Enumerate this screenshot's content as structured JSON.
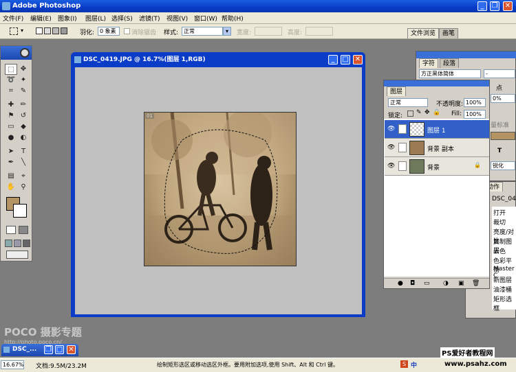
{
  "app": {
    "title": "Adobe Photoshop",
    "logo_icon": "photoshop-icon"
  },
  "menu": [
    "文件(F)",
    "编辑(E)",
    "图象(I)",
    "图层(L)",
    "选择(S)",
    "滤镜(T)",
    "视图(V)",
    "窗口(W)",
    "帮助(H)"
  ],
  "options": {
    "feather_label": "羽化:",
    "feather_value": "0 象素",
    "antialias_label": "消除锯齿",
    "style_label": "样式:",
    "style_value": "正常",
    "width_label": "宽度:",
    "height_label": "高度:",
    "tabs": [
      "文件浏览",
      "画笔"
    ]
  },
  "document": {
    "title": "DSC_0419.JPG @ 16.7%(图层 1,RGB)",
    "badge": "01"
  },
  "char_panel": {
    "tabs": [
      "字符",
      "段落"
    ],
    "font": "方正黑体简体",
    "dash": "-",
    "pt": "点",
    "percent": "0%",
    "scale": "量标准",
    "aa": "锐化"
  },
  "history_panel": {
    "tabs": [
      "记录",
      "动作"
    ],
    "file": "DSC_04",
    "items": [
      "打开",
      "裁切",
      "亮度/对比",
      "复制图层",
      "去色",
      "色彩平衡",
      "Master C",
      "新图层",
      "油漆桶",
      "矩形选框"
    ]
  },
  "layers": {
    "tab": "图层",
    "blend": "正常",
    "opacity_label": "不透明度:",
    "opacity_value": "100%",
    "lock_label": "锁定:",
    "fill_label": "Fill:",
    "fill_value": "100%",
    "rows": [
      {
        "name": "图层 1",
        "selected": true
      },
      {
        "name": "背景 副本",
        "selected": false
      },
      {
        "name": "背景",
        "selected": false
      }
    ]
  },
  "watermark": {
    "brand": "POCO 摄影专题",
    "url": "http://photo.poco.cn/"
  },
  "minimized": {
    "title": "DSC_..."
  },
  "status": {
    "zoom": "16.67%",
    "doc": "文档:9.5M/23.2M",
    "hint": "绘制矩形选区或移动选区外框。要用附加选项,使用 Shift、Alt 和 Ctrl 键。",
    "ime": "中",
    "site_name": "PS爱好者教程网",
    "site_url": "www.psahz.com"
  },
  "colors": {
    "title_blue": "#0a3cc8",
    "layer_selected": "#3161c8",
    "ui_gray": "#d4d0c8",
    "fg_swatch": "#b59464"
  }
}
